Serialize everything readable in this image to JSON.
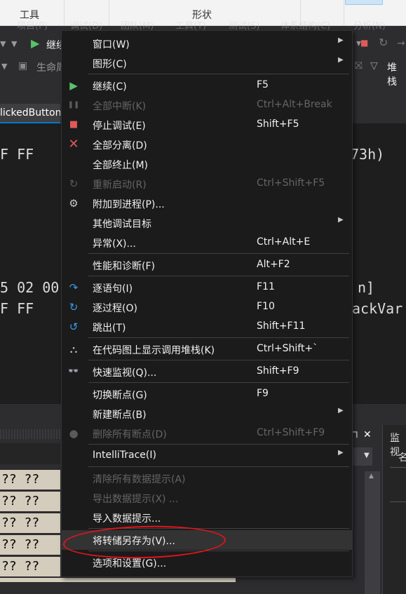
{
  "ribbon": {
    "tools_label": "工具",
    "shape_label": "形状"
  },
  "menubar": {
    "items": [
      "项目(P)",
      "调试(D)",
      "团队(M)",
      "工具(T)",
      "测试(S)",
      "体系结构(C)",
      "分析(N)"
    ]
  },
  "toolbar": {
    "continue_label": "继续",
    "lifecycle_label": "生命周",
    "stack_label": "堆栈"
  },
  "doc_tab": {
    "label": "lickedButton"
  },
  "editor": {
    "lines": [
      "F FF",
      "73h)",
      "5 02 00",
      "n]",
      "F FF",
      "ackVar"
    ]
  },
  "memory": {
    "rows": [
      "?? ??",
      "?? ??",
      "?? ??",
      "?? ??",
      "?? ??"
    ]
  },
  "side_panel": {
    "close_label": "✕",
    "watch_label": "监视",
    "name_label": "名"
  },
  "menu": {
    "items": [
      {
        "label": "窗口(W)",
        "shortcut": "",
        "icon": "",
        "arrow": "▶"
      },
      {
        "label": "图形(C)",
        "shortcut": "",
        "icon": "",
        "arrow": "▶"
      },
      {
        "label": "继续(C)",
        "shortcut": "F5",
        "icon": "▶",
        "arrow": ""
      },
      {
        "label": "全部中断(K)",
        "shortcut": "Ctrl+Alt+Break",
        "icon": "❚❚",
        "arrow": ""
      },
      {
        "label": "停止调试(E)",
        "shortcut": "Shift+F5",
        "icon": "■",
        "arrow": ""
      },
      {
        "label": "全部分离(D)",
        "shortcut": "",
        "icon": "✕",
        "arrow": ""
      },
      {
        "label": "全部终止(M)",
        "shortcut": "",
        "icon": "",
        "arrow": ""
      },
      {
        "label": "重新启动(R)",
        "shortcut": "Ctrl+Shift+F5",
        "icon": "↻",
        "arrow": ""
      },
      {
        "label": "附加到进程(P)...",
        "shortcut": "",
        "icon": "⚙",
        "arrow": ""
      },
      {
        "label": "其他调试目标",
        "shortcut": "",
        "icon": "",
        "arrow": "▶"
      },
      {
        "label": "异常(X)...",
        "shortcut": "Ctrl+Alt+E",
        "icon": "",
        "arrow": ""
      },
      {
        "label": "性能和诊断(F)",
        "shortcut": "Alt+F2",
        "icon": "",
        "arrow": ""
      },
      {
        "label": "逐语句(I)",
        "shortcut": "F11",
        "icon": "↷",
        "arrow": ""
      },
      {
        "label": "逐过程(O)",
        "shortcut": "F10",
        "icon": "↻",
        "arrow": ""
      },
      {
        "label": "跳出(T)",
        "shortcut": "Shift+F11",
        "icon": "↺",
        "arrow": ""
      },
      {
        "label": "在代码图上显示调用堆栈(K)",
        "shortcut": "Ctrl+Shift+`",
        "icon": "⛬",
        "arrow": ""
      },
      {
        "label": "快速监视(Q)...",
        "shortcut": "Shift+F9",
        "icon": "👓",
        "arrow": ""
      },
      {
        "label": "切换断点(G)",
        "shortcut": "F9",
        "icon": "",
        "arrow": ""
      },
      {
        "label": "新建断点(B)",
        "shortcut": "",
        "icon": "",
        "arrow": "▶"
      },
      {
        "label": "删除所有断点(D)",
        "shortcut": "Ctrl+Shift+F9",
        "icon": "●",
        "arrow": ""
      },
      {
        "label": "IntelliTrace(I)",
        "shortcut": "",
        "icon": "",
        "arrow": "▶"
      },
      {
        "label": "清除所有数据提示(A)",
        "shortcut": "",
        "icon": "",
        "arrow": ""
      },
      {
        "label": "导出数据提示(X) ...",
        "shortcut": "",
        "icon": "",
        "arrow": ""
      },
      {
        "label": "导入数据提示...",
        "shortcut": "",
        "icon": "",
        "arrow": ""
      },
      {
        "label": "将转储另存为(V)...",
        "shortcut": "",
        "icon": "",
        "arrow": ""
      },
      {
        "label": "选项和设置(G)...",
        "shortcut": "",
        "icon": "",
        "arrow": ""
      }
    ]
  },
  "colors": {
    "continue": "#57c36c",
    "stop": "#e05a5a",
    "detach": "#e05a5a",
    "step": "#3c9ae8",
    "annotation": "#e0151b"
  }
}
